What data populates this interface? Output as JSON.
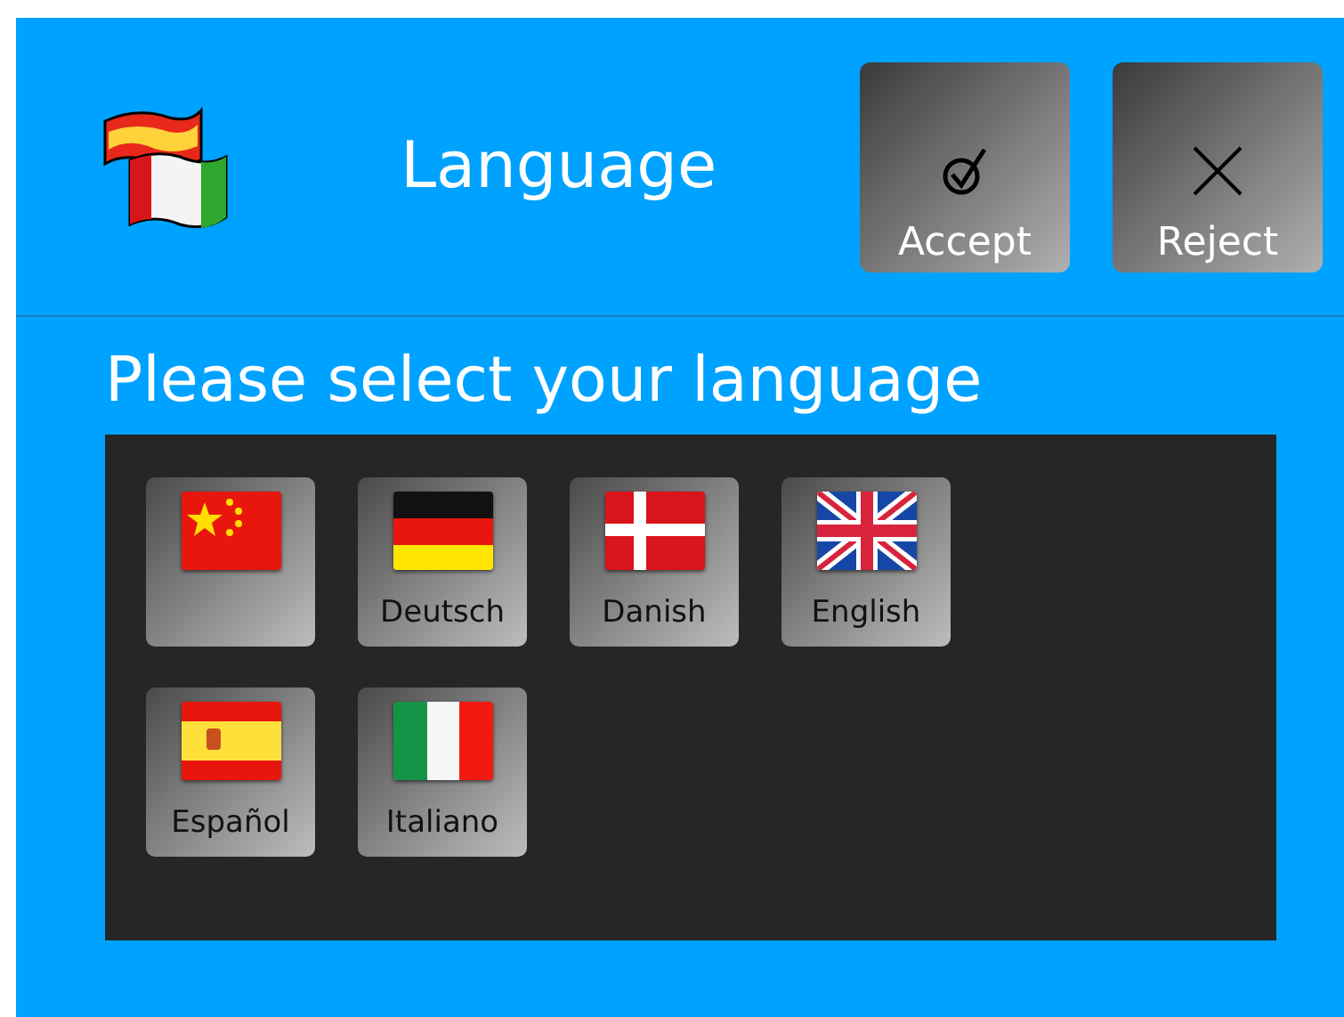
{
  "header": {
    "title": "Language",
    "buttons": [
      {
        "kind": "accept",
        "label": "Accept"
      },
      {
        "kind": "reject",
        "label": "Reject"
      }
    ]
  },
  "prompt": "Please select your language",
  "languages": [
    {
      "kind": "cn"
    },
    {
      "kind": "de",
      "label": "Deutsch"
    },
    {
      "kind": "dk",
      "label": "Danish"
    },
    {
      "kind": "gb",
      "label": "English"
    },
    {
      "kind": "es",
      "label": "Español"
    },
    {
      "kind": "it",
      "label": "Italiano"
    }
  ]
}
